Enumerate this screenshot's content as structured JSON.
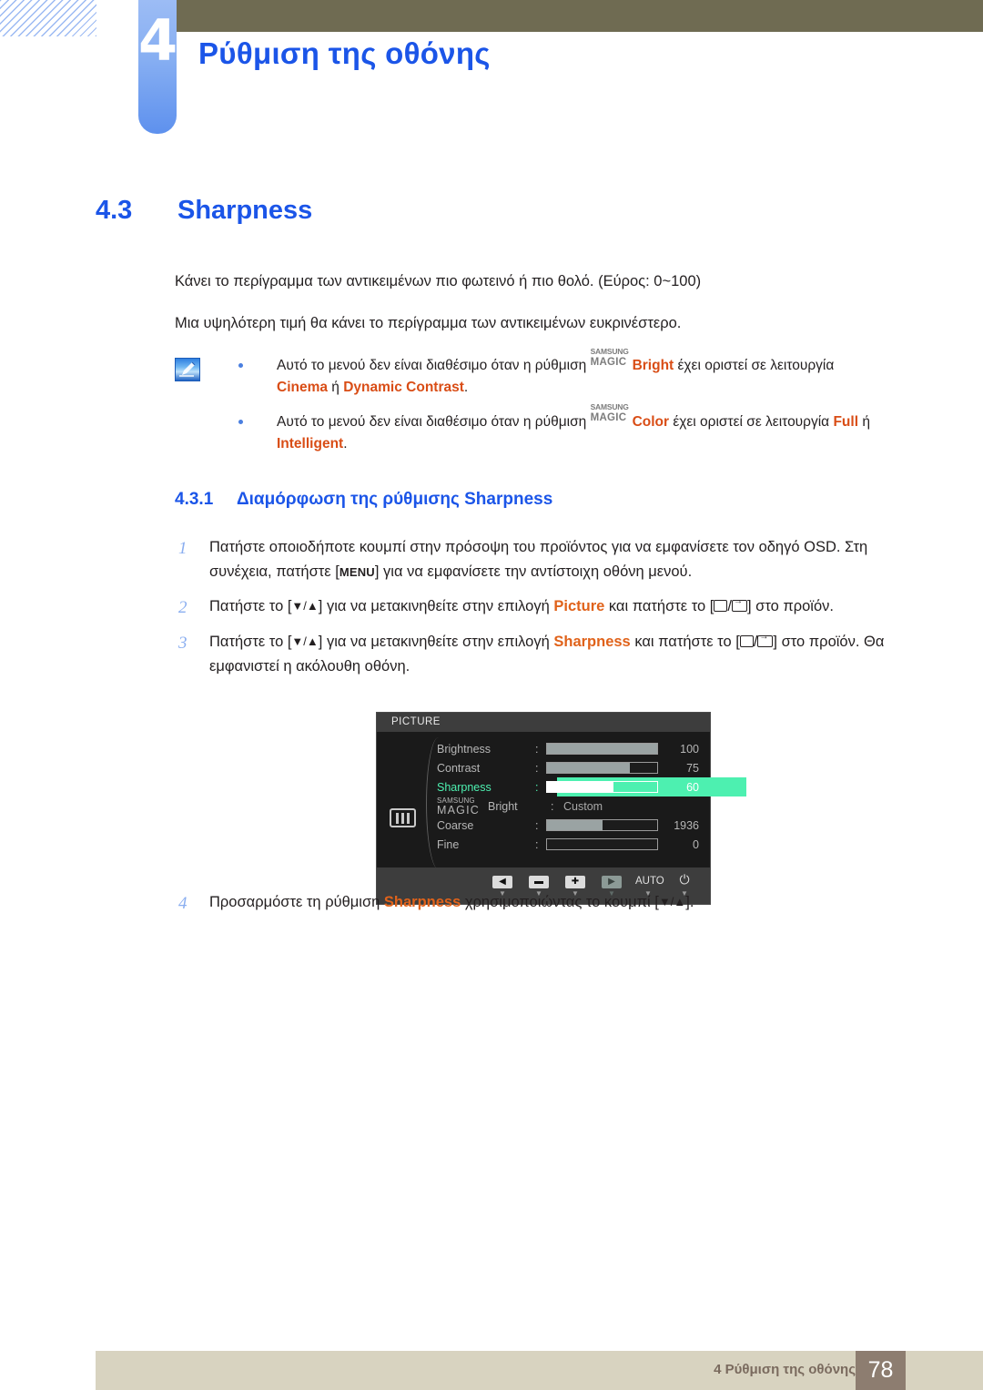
{
  "header": {
    "chapter_number": "4",
    "chapter_title": "Ρύθμιση της οθόνης"
  },
  "section": {
    "number": "4.3",
    "title": "Sharpness"
  },
  "paragraphs": {
    "p1": "Κάνει το περίγραμμα των αντικειμένων πιο φωτεινό ή πιο θολό. (Εύρος: 0~100)",
    "p2": "Μια υψηλότερη τιμή θα κάνει το περίγραμμα των αντικειμένων ευκρινέστερο."
  },
  "note": {
    "icon": "note-pen-icon",
    "bullets": [
      {
        "text_before": "Αυτό το μενού δεν είναι διαθέσιμο όταν η ρύθμιση ",
        "magic_top": "SAMSUNG",
        "magic_bottom": "MAGIC",
        "magic_suffix": "Bright",
        "text_mid": " έχει οριστεί σε λειτουργία ",
        "value1": "Cinema",
        "conj": " ή ",
        "value2": "Dynamic Contrast",
        "text_end": "."
      },
      {
        "text_before": "Αυτό το μενού δεν είναι διαθέσιμο όταν η ρύθμιση ",
        "magic_top": "SAMSUNG",
        "magic_bottom": "MAGIC",
        "magic_suffix": "Color",
        "text_mid": " έχει οριστεί σε λειτουργία ",
        "value1": "Full",
        "conj": " ή ",
        "value2": "Intelligent",
        "text_end": "."
      }
    ]
  },
  "subsection": {
    "number": "4.3.1",
    "title": "Διαμόρφωση της ρύθμισης Sharpness"
  },
  "steps": [
    {
      "num": "1",
      "part_a": "Πατήστε οποιοδήποτε κουμπί στην πρόσοψη του προϊόντος για να εμφανίσετε τον οδηγό OSD. Στη συνέχεια, πατήστε [",
      "key": "MENU",
      "part_b": "] για να εμφανίσετε την αντίστοιχη οθόνη μενού."
    },
    {
      "num": "2",
      "part_a": "Πατήστε το [",
      "arrows": "▼/▲",
      "part_b": "] για να μετακινηθείτε στην επιλογή ",
      "highlight": "Picture",
      "part_c": " και πατήστε το [",
      "part_d": "] στο προϊόν."
    },
    {
      "num": "3",
      "part_a": "Πατήστε το [",
      "arrows": "▼/▲",
      "part_b": "] για να μετακινηθείτε στην επιλογή ",
      "highlight": "Sharpness",
      "part_c": " και πατήστε το [",
      "part_d": "] στο προϊόν. Θα εμφανιστεί η ακόλουθη οθόνη."
    },
    {
      "num": "4",
      "part_a": "Προσαρμόστε τη ρύθμιση ",
      "highlight": "Sharpness",
      "part_b": " χρησιμοποιώντας το κουμπί [",
      "arrows": "▼/▲",
      "part_c": "]."
    }
  ],
  "osd": {
    "title": "PICTURE",
    "menu_icon": "picture-tiles-icon",
    "rows": [
      {
        "label": "Brightness",
        "colon": ":",
        "value": "100",
        "fill_pct": 100,
        "type": "bar",
        "selected": false
      },
      {
        "label": "Contrast",
        "colon": ":",
        "value": "75",
        "fill_pct": 75,
        "type": "bar",
        "selected": false
      },
      {
        "label": "Sharpness",
        "colon": ":",
        "value": "60",
        "fill_pct": 60,
        "type": "bar",
        "selected": true
      },
      {
        "label_top": "SAMSUNG",
        "label_mid": "MAGIC",
        "label_suffix": "Bright",
        "colon": ":",
        "value": "Custom",
        "type": "text",
        "selected": false
      },
      {
        "label": "Coarse",
        "colon": ":",
        "value": "1936",
        "fill_pct": 50,
        "type": "bar",
        "selected": false
      },
      {
        "label": "Fine",
        "colon": ":",
        "value": "0",
        "fill_pct": 0,
        "type": "bar",
        "selected": false
      }
    ],
    "footer_buttons": [
      {
        "glyph": "◀",
        "name": "left-arrow-button",
        "style": "light"
      },
      {
        "glyph": "▬",
        "name": "minus-button",
        "style": "light"
      },
      {
        "glyph": "✚",
        "name": "plus-button",
        "style": "light"
      },
      {
        "glyph": "▶",
        "name": "right-arrow-button",
        "style": "dim"
      },
      {
        "glyph": "AUTO",
        "name": "auto-button",
        "style": "text"
      },
      {
        "glyph": "⏻",
        "name": "power-button",
        "style": "power"
      }
    ],
    "colors": {
      "highlight": "#4df0b0",
      "background": "#1a1a1a",
      "titlebar": "#3d3d3d"
    }
  },
  "footer": {
    "text": "4 Ρύθμιση της οθόνης",
    "page": "78"
  }
}
